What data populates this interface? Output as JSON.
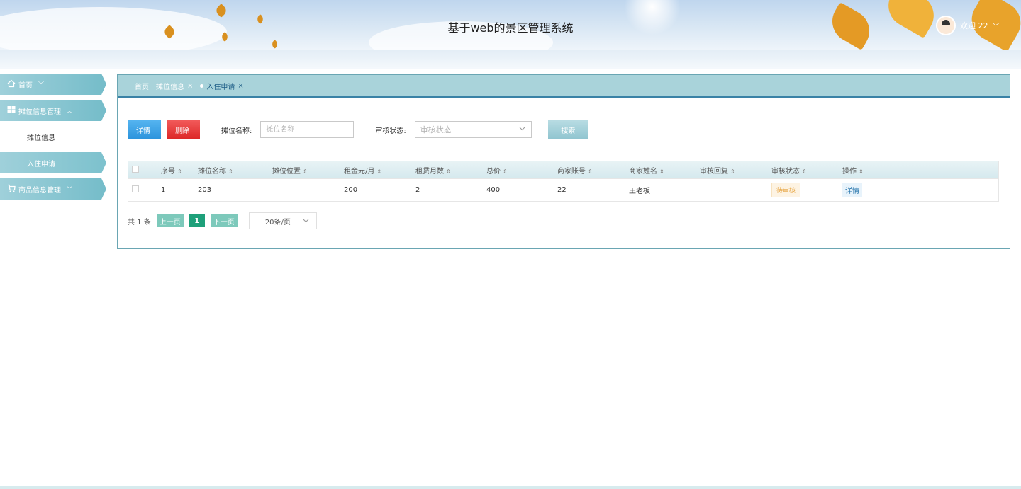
{
  "header": {
    "title": "基于web的景区管理系统",
    "welcome": "欢迎 22",
    "user_chevron": "﹀"
  },
  "sidebar": {
    "items": [
      {
        "label": "首页",
        "icon": "home-icon",
        "chevron": "﹀"
      },
      {
        "label": "摊位信息管理",
        "icon": "grid-icon",
        "chevron": "︿"
      },
      {
        "label": "摊位信息"
      },
      {
        "label": "入住申请"
      },
      {
        "label": "商品信息管理",
        "icon": "cart-icon",
        "chevron": "﹀"
      }
    ]
  },
  "tabs": [
    {
      "label": "首页"
    },
    {
      "label": "摊位信息",
      "close": "×"
    },
    {
      "label": "入住申请",
      "close": "×"
    }
  ],
  "toolbar": {
    "detail_label": "详情",
    "delete_label": "删除",
    "name_label": "摊位名称:",
    "name_placeholder": "摊位名称",
    "status_label": "审核状态:",
    "status_placeholder": "审核状态",
    "search_label": "搜索"
  },
  "table": {
    "columns": [
      "序号",
      "摊位名称",
      "摊位位置",
      "租金元/月",
      "租赁月数",
      "总价",
      "商家账号",
      "商家姓名",
      "审核回复",
      "审核状态",
      "操作"
    ],
    "rows": [
      {
        "index": "1",
        "stall_name": "203",
        "stall_location": "",
        "rent": "200",
        "months": "2",
        "total": "400",
        "merchant_account": "22",
        "merchant_name": "王老板",
        "reply": "",
        "status": "待审核",
        "action": "详情"
      }
    ]
  },
  "pagination": {
    "total_text": "共 1 条",
    "prev": "上一页",
    "current": "1",
    "next": "下一页",
    "page_size": "20条/页"
  },
  "colors": {
    "sidebar": "#74bcc9",
    "tabbar": "#a9d3da",
    "primary": "#2b93dc",
    "danger": "#dc2626",
    "pending": "#e6a23c",
    "page_active": "#1ea07a"
  }
}
